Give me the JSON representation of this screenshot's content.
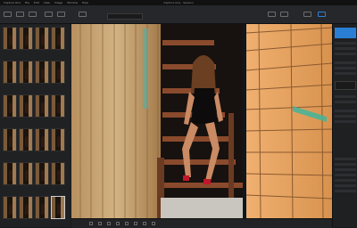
{
  "menubar": {
    "items": [
      "Capture One",
      "File",
      "Edit",
      "View",
      "Image",
      "Window",
      "Help"
    ]
  },
  "window": {
    "title": "Capture One - Session"
  },
  "toolbar": {
    "buttons": [
      "Import",
      "Capture",
      "Browse",
      "Workspace",
      "Cursor",
      "View",
      "Export"
    ],
    "search_placeholder": ""
  },
  "browser": {
    "thumbnail_count": 12,
    "selected_index": 11
  },
  "viewer": {
    "photo_description_icon": "photo-viewer"
  },
  "bottombar": {
    "tools": [
      "pan-icon",
      "crop-icon",
      "rotate-icon",
      "heal-icon",
      "brush-icon",
      "picker-icon",
      "wb-icon",
      "zoom-icon"
    ]
  },
  "rightpanel": {
    "sections": [
      "Histogram",
      "Exposure",
      "White Balance",
      "Levels",
      "Curve",
      "Color",
      "Details",
      "Metadata"
    ]
  },
  "colors": {
    "accent": "#2a7fd4",
    "panel": "#1f2022"
  }
}
